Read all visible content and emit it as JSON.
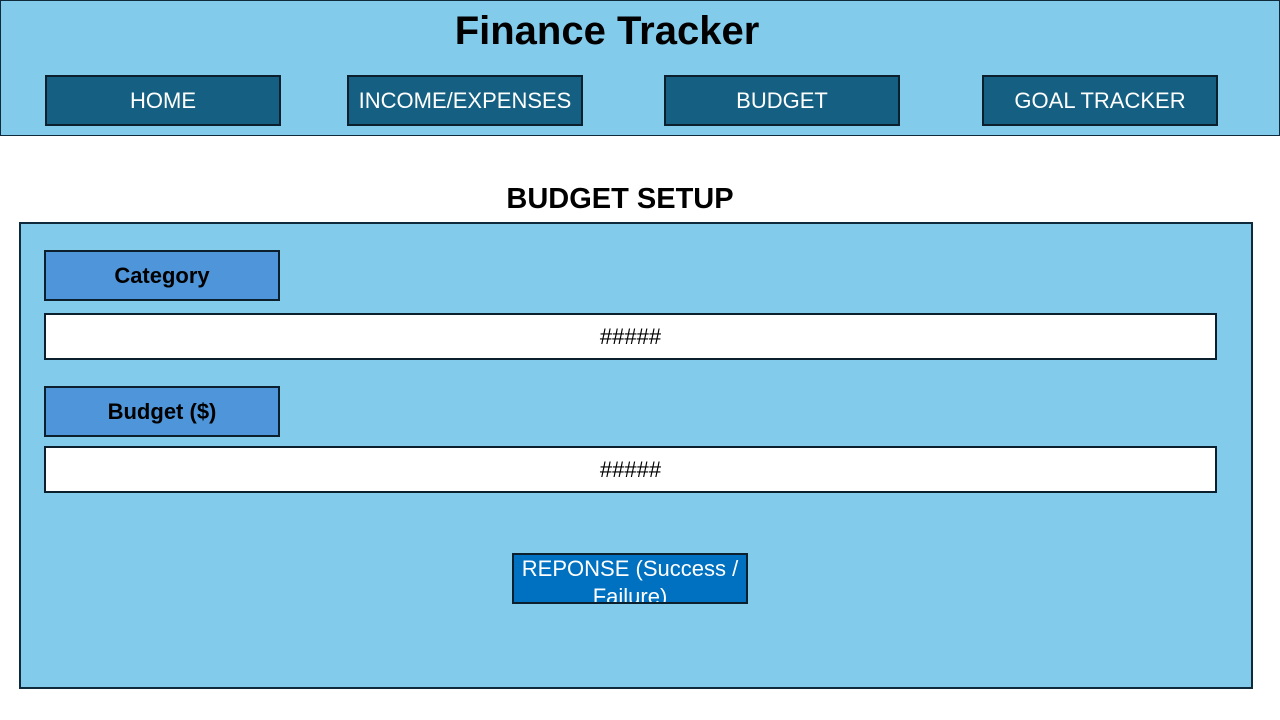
{
  "header": {
    "title": "Finance Tracker",
    "nav": [
      {
        "label": "HOME"
      },
      {
        "label": "INCOME/EXPENSES"
      },
      {
        "label": "BUDGET"
      },
      {
        "label": "GOAL TRACKER"
      }
    ]
  },
  "budget_setup": {
    "title": "BUDGET SETUP",
    "category_label": "Category",
    "category_value": "#####",
    "budget_label": "Budget ($)",
    "budget_value": "#####",
    "response_text": "REPONSE (Success / Failure)"
  },
  "colors": {
    "header_bg": "#83cbeb",
    "nav_button": "#156082",
    "label_box": "#4e95d9",
    "response_box": "#0070c0"
  }
}
